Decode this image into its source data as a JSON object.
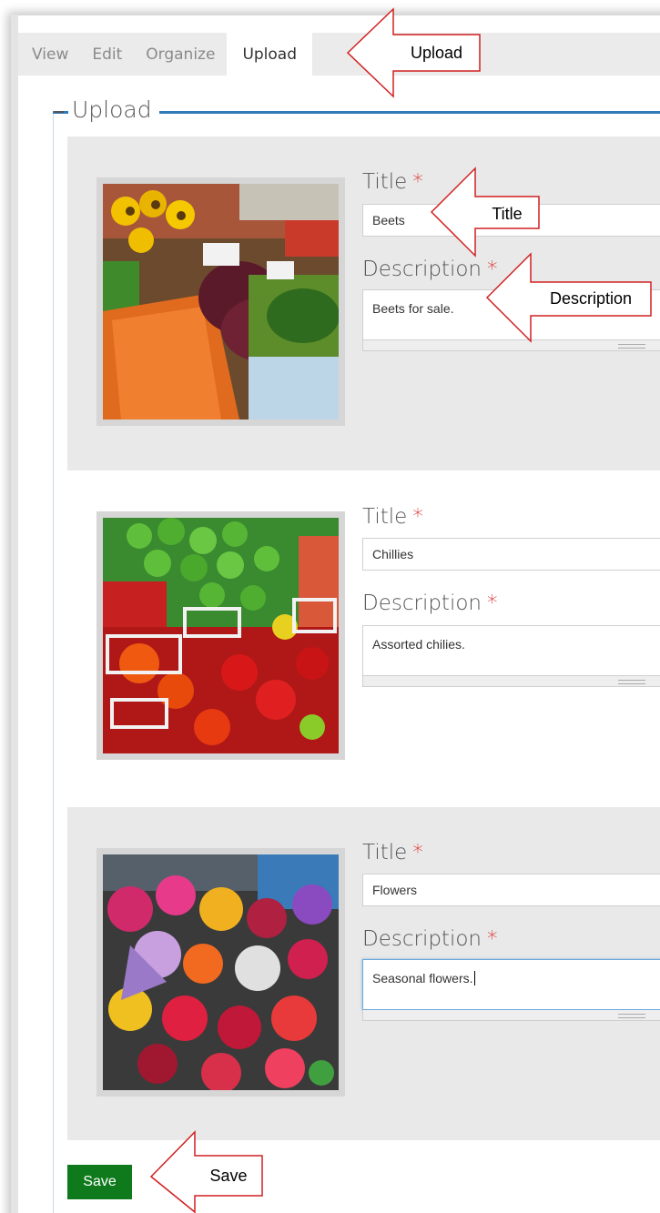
{
  "tabs": [
    {
      "label": "View",
      "active": false
    },
    {
      "label": "Edit",
      "active": false
    },
    {
      "label": "Organize",
      "active": false
    },
    {
      "label": "Upload",
      "active": true
    }
  ],
  "fieldset": {
    "legend": "Upload"
  },
  "field_labels": {
    "title": "Title",
    "description": "Description",
    "required_mark": "*"
  },
  "items": [
    {
      "photo": "beets-photo",
      "title": "Beets",
      "description": "Beets for sale.",
      "focused": false
    },
    {
      "photo": "chillies-photo",
      "title": "Chillies",
      "description": "Assorted chilies.",
      "focused": false
    },
    {
      "photo": "flowers-photo",
      "title": "Flowers",
      "description": "Seasonal flowers.",
      "focused": true
    }
  ],
  "save_button": {
    "label": "Save",
    "color": "#0f7a1c"
  },
  "callouts": {
    "upload": "Upload",
    "title": "Title",
    "description": "Description",
    "save": "Save"
  },
  "colors": {
    "legend_accent": "#2f7ab8",
    "required": "#dd2222",
    "row_shade": "#e9e9e9"
  }
}
